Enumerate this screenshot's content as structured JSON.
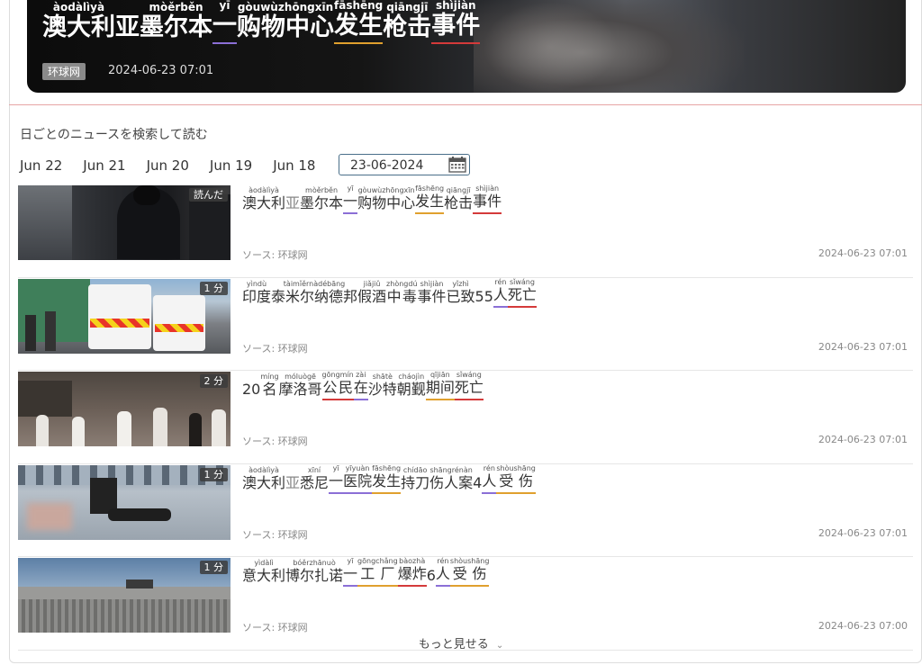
{
  "hero": {
    "title_tokens": [
      {
        "t": "澳大利",
        "r": "àodàlìyà",
        "u": ""
      },
      {
        "t": "亚",
        "r": "",
        "u": "",
        "light": true
      },
      {
        "t": "墨尔本",
        "r": "mòěrběn",
        "u": ""
      },
      {
        "t": "一",
        "r": "yī",
        "u": "purple"
      },
      {
        "t": "购物中心",
        "r": "gòuwùzhōngxīn",
        "u": ""
      },
      {
        "t": "发生",
        "r": "fāshēng",
        "u": "orange"
      },
      {
        "t": "枪击",
        "r": "qiāngjī",
        "u": ""
      },
      {
        "t": "事件",
        "r": "shìjiàn",
        "u": "red"
      }
    ],
    "source": "环球网",
    "date": "2024-06-23 07:01"
  },
  "search": {
    "label": "日ごとのニュースを検索して読む",
    "days": [
      "Jun 22",
      "Jun 21",
      "Jun 20",
      "Jun 19",
      "Jun 18"
    ],
    "date_value": "23-06-2024"
  },
  "articles": [
    {
      "badge": "読んだ",
      "thumb": "police",
      "source": "ソース: 环球网",
      "date": "2024-06-23 07:01",
      "tokens": [
        {
          "t": "澳大利",
          "r": "àodàlìyà",
          "u": ""
        },
        {
          "t": "亚",
          "r": "",
          "u": "",
          "light": true
        },
        {
          "t": "墨尔本",
          "r": "mòěrběn",
          "u": ""
        },
        {
          "t": "一",
          "r": "yī",
          "u": "purple"
        },
        {
          "t": "购物中心",
          "r": "gòuwùzhōngxīn",
          "u": ""
        },
        {
          "t": "发生",
          "r": "fāshēng",
          "u": "orange"
        },
        {
          "t": "枪击",
          "r": "qiāngjī",
          "u": ""
        },
        {
          "t": "事件",
          "r": "shìjiàn",
          "u": "red"
        }
      ]
    },
    {
      "badge": "1 分",
      "thumb": "ambulance",
      "source": "ソース: 环球网",
      "date": "2024-06-23 07:01",
      "tokens": [
        {
          "t": "印度",
          "r": "yìndù",
          "u": ""
        },
        {
          "t": "泰米尔纳德邦",
          "r": "tàimǐěrnàdébāng",
          "u": ""
        },
        {
          "t": "假酒",
          "r": "jiǎjiǔ",
          "u": ""
        },
        {
          "t": "中毒",
          "r": "zhòngdú",
          "u": ""
        },
        {
          "t": "事件",
          "r": "shìjiàn",
          "u": ""
        },
        {
          "t": "已致",
          "r": "yǐzhì",
          "u": ""
        },
        {
          "t": "55",
          "r": "",
          "u": ""
        },
        {
          "t": "人",
          "r": "rén",
          "u": "purple"
        },
        {
          "t": "死亡",
          "r": "sǐwáng",
          "u": "red"
        }
      ]
    },
    {
      "badge": "2 分",
      "thumb": "pilgrims",
      "source": "ソース: 环球网",
      "date": "2024-06-23 07:01",
      "tokens": [
        {
          "t": "20",
          "r": "",
          "u": ""
        },
        {
          "t": "名",
          "r": "míng",
          "u": ""
        },
        {
          "t": "摩洛哥",
          "r": "móluògē",
          "u": ""
        },
        {
          "t": "公民",
          "r": "gōngmín",
          "u": "red"
        },
        {
          "t": "在",
          "r": "zài",
          "u": "purple"
        },
        {
          "t": "沙特",
          "r": "shātè",
          "u": ""
        },
        {
          "t": "朝觐",
          "r": "cháojìn",
          "u": ""
        },
        {
          "t": "期间",
          "r": "qījiān",
          "u": "orange"
        },
        {
          "t": "死亡",
          "r": "sǐwáng",
          "u": "red"
        }
      ]
    },
    {
      "badge": "1 分",
      "thumb": "hospital",
      "source": "ソース: 环球网",
      "date": "2024-06-23 07:01",
      "tokens": [
        {
          "t": "澳大利",
          "r": "àodàlìyà",
          "u": ""
        },
        {
          "t": "亚",
          "r": "",
          "u": "",
          "light": true
        },
        {
          "t": "悉尼",
          "r": "xīní",
          "u": ""
        },
        {
          "t": "一",
          "r": "yī",
          "u": "purple"
        },
        {
          "t": "医院",
          "r": "yīyuàn",
          "u": "purple"
        },
        {
          "t": "发生",
          "r": "fāshēng",
          "u": "orange"
        },
        {
          "t": "持刀",
          "r": "chídāo",
          "u": ""
        },
        {
          "t": "伤人案",
          "r": "shāngrénàn",
          "u": ""
        },
        {
          "t": " 4",
          "r": "",
          "u": ""
        },
        {
          "t": "人",
          "r": "rén",
          "u": "purple"
        },
        {
          "t": "受伤",
          "r": "shòushāng",
          "u": "orange"
        }
      ]
    },
    {
      "badge": "1 分",
      "thumb": "factory",
      "source": "ソース: 环球网",
      "date": "2024-06-23 07:00",
      "tokens": [
        {
          "t": "意大利",
          "r": "yìdàlì",
          "u": ""
        },
        {
          "t": "博尔扎诺",
          "r": "bóěrzhānuò",
          "u": ""
        },
        {
          "t": "一",
          "r": "yī",
          "u": "purple"
        },
        {
          "t": "工厂",
          "r": "gōngchǎng",
          "u": "orange"
        },
        {
          "t": "爆炸",
          "r": "bàozhà",
          "u": "red"
        },
        {
          "t": " 6",
          "r": "",
          "u": ""
        },
        {
          "t": "人",
          "r": "rén",
          "u": "purple"
        },
        {
          "t": "受伤",
          "r": "shòushāng",
          "u": "orange"
        }
      ]
    }
  ],
  "more_label": "もっと見せる",
  "icons": {
    "calendar": "calendar-icon",
    "chevron": "chevron-down-icon"
  },
  "colors": {
    "underline_purple": "#8b6fd6",
    "underline_orange": "#e0a02e",
    "underline_red": "#d43a3a"
  }
}
